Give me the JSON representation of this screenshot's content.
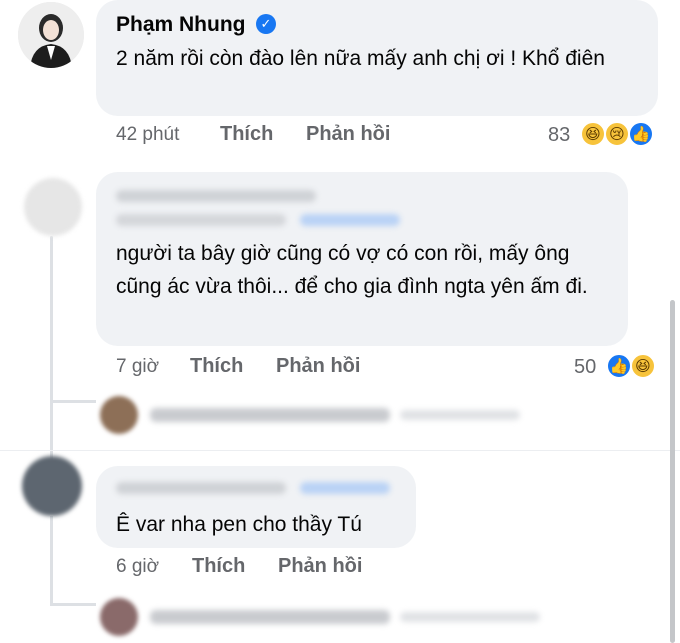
{
  "comments": [
    {
      "author": "Phạm Nhung",
      "text": "2 năm rồi còn đào lên nữa mấy anh chị ơi ! Khổ điên",
      "time": "42 phút",
      "like": "Thích",
      "reply": "Phản hồi",
      "reaction_count": "83",
      "verified_glyph": "✓"
    },
    {
      "text": "người ta bây giờ cũng có vợ có con rồi, mấy ông cũng ác vừa thôi... để cho gia đình ngta yên ấm đi.",
      "time": "7 giờ",
      "like": "Thích",
      "reply": "Phản hồi",
      "reaction_count": "50"
    },
    {
      "text": "Ê var nha pen cho thầy Tú",
      "time": "6 giờ",
      "like": "Thích",
      "reply": "Phản hồi"
    }
  ],
  "emoji": {
    "haha": "😆",
    "sad": "😢",
    "like": "👍"
  },
  "colors": {
    "bubble": "#f0f2f5",
    "meta": "#65676b",
    "accent": "#1877f2"
  }
}
